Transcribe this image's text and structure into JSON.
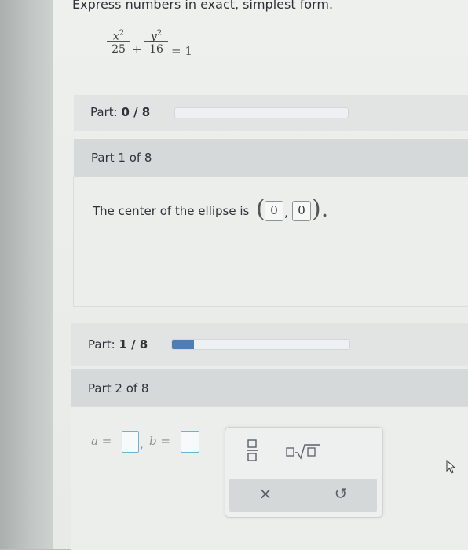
{
  "instruction": "Express numbers in exact, simplest form.",
  "equation": {
    "term1_num": "x",
    "term1_exp": "2",
    "term1_den": "25",
    "plus": "+",
    "term2_num": "y",
    "term2_exp": "2",
    "term2_den": "16",
    "equals": "= 1"
  },
  "progress_top": {
    "label_prefix": "Part: ",
    "label_value": "0 / 8",
    "fraction": 0
  },
  "part1": {
    "header": "Part 1 of 8",
    "statement": "The center of the ellipse is",
    "open_paren": "(",
    "x_value": "0",
    "comma": ",",
    "y_value": "0",
    "close_paren": ").",
    "period": ""
  },
  "progress_mid": {
    "label_prefix": "Part: ",
    "label_value": "1 / 8",
    "fraction": 0.125
  },
  "part2": {
    "header": "Part 2 of 8",
    "a_label": "a =",
    "comma": ",",
    "b_label": "b ="
  },
  "toolpad": {
    "fraction_icon": "fraction-icon",
    "sqrt_icon": "sqrt-icon",
    "sqrt_symbol": "□√□",
    "clear_symbol": "×",
    "undo_symbol": "↺"
  },
  "cursor_icon": "mouse-pointer-icon",
  "colors": {
    "accent": "#4d7fb0",
    "input_border": "#6fb0d6"
  }
}
